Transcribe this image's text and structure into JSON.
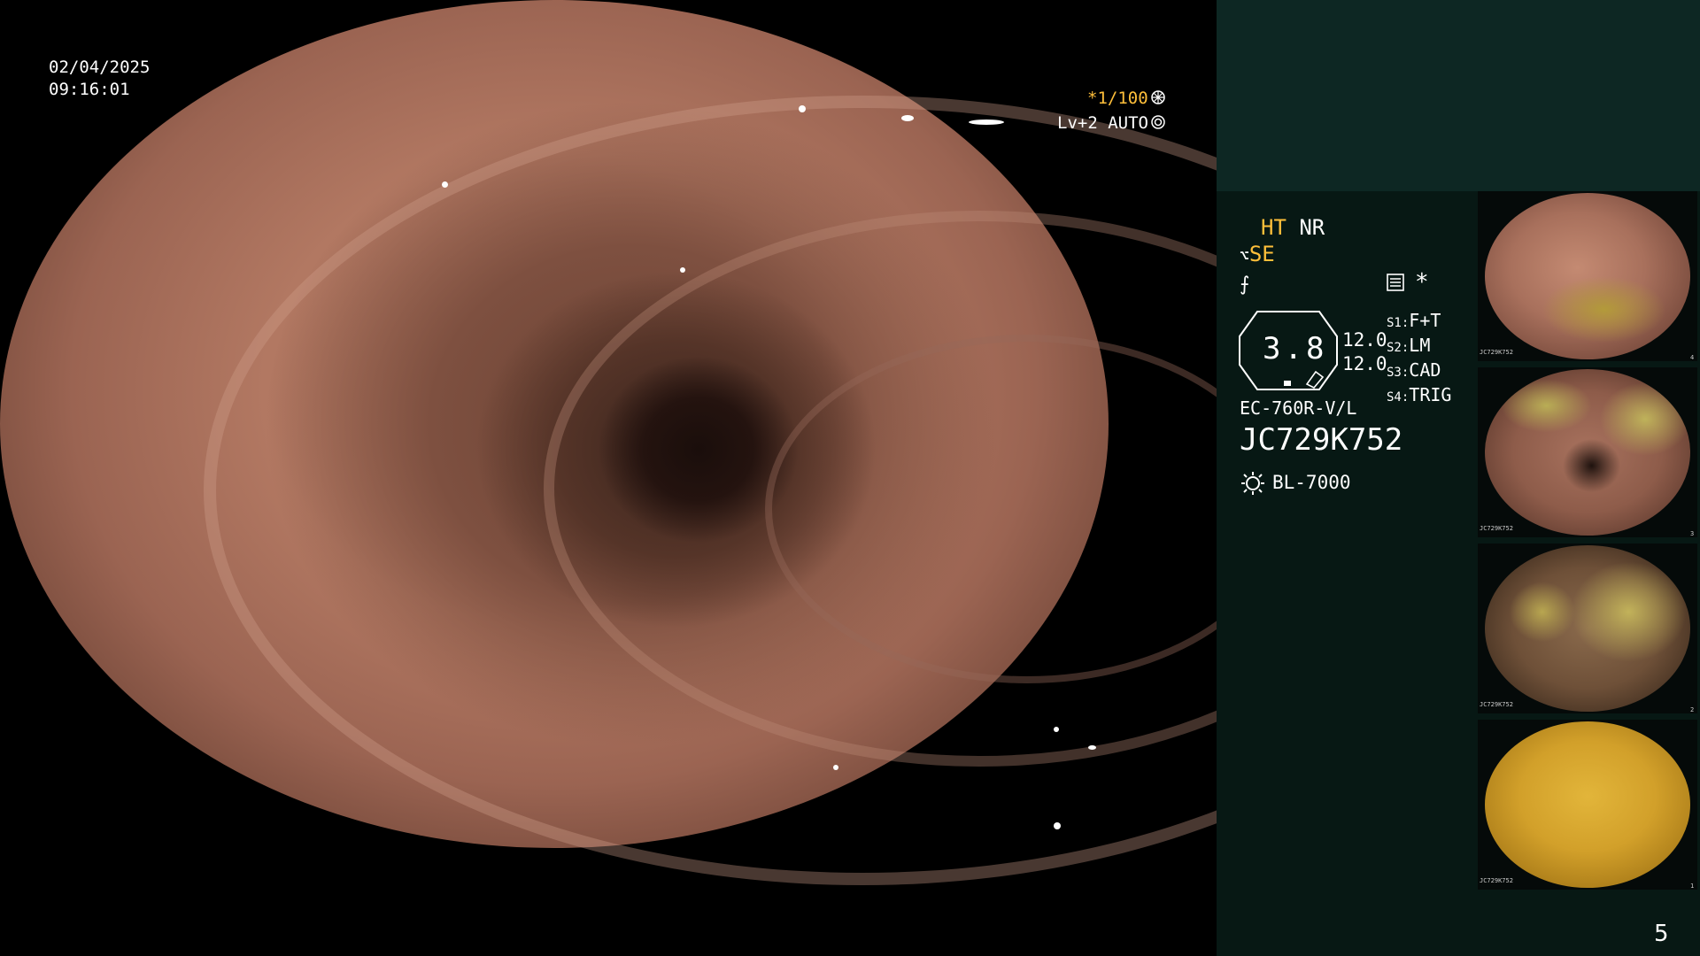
{
  "overlay": {
    "date": "02/04/2025",
    "time": "09:16:01",
    "shutter": "*1/100",
    "iris": "Lv+2 AUTO"
  },
  "panel": {
    "ht": "HT",
    "nr": "NR",
    "se": "SE",
    "zoom_value": "3.8",
    "value_a": "12.0",
    "value_b": "12.0",
    "s1_label": "S1:",
    "s1_value": "F+T",
    "s2_label": "S2:",
    "s2_value": "LM",
    "s3_label": "S3:",
    "s3_value": "CAD",
    "s4_label": "S4:",
    "s4_value": "TRIG",
    "scope_model": "EC-760R-V/L",
    "serial": "JC729K752",
    "light_source": "BL-7000",
    "page_number": "5"
  },
  "thumbnails": [
    {
      "serial": "JC729K752",
      "index": "4"
    },
    {
      "serial": "JC729K752",
      "index": "3"
    },
    {
      "serial": "JC729K752",
      "index": "2"
    },
    {
      "serial": "JC729K752",
      "index": "1"
    }
  ],
  "colors": {
    "accent_yellow": "#ffbf3a",
    "panel_top": "#0d2723",
    "panel_bottom": "#071814"
  }
}
